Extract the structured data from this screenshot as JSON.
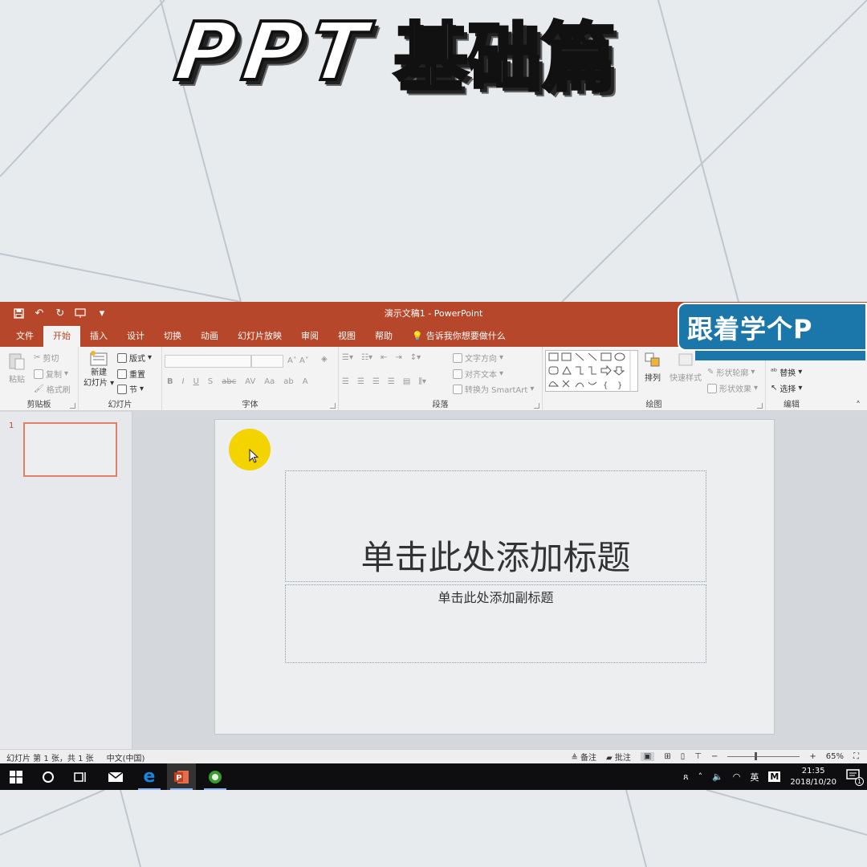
{
  "headline": {
    "ppt": "PPT",
    "cn": "基础篇"
  },
  "brand_tag": "跟着学个P",
  "window": {
    "doc_title": "演示文稿1  -  PowerPoint",
    "tabs": [
      "文件",
      "开始",
      "插入",
      "设计",
      "切换",
      "动画",
      "幻灯片放映",
      "审阅",
      "视图",
      "帮助"
    ],
    "active_tab": "开始",
    "tell_me": "告诉我你想要做什么",
    "ribbon": {
      "clipboard": {
        "label": "剪贴板",
        "paste": "粘贴",
        "cut": "剪切",
        "copy": "复制",
        "format_painter": "格式刷"
      },
      "slides": {
        "label": "幻灯片",
        "new_slide_1": "新建",
        "new_slide_2": "幻灯片",
        "layout": "版式",
        "reset": "重置",
        "section": "节"
      },
      "font": {
        "label": "字体",
        "bold": "B",
        "italic": "I",
        "underline": "U",
        "shadow": "S",
        "strike": "abc",
        "spacing": "AV",
        "case": "Aa",
        "highlight": "ab",
        "color": "A"
      },
      "paragraph": {
        "label": "段落",
        "text_direction": "文字方向",
        "align_text": "对齐文本",
        "smartart": "转换为 SmartArt"
      },
      "drawing": {
        "label": "绘图",
        "arrange": "排列",
        "quick_styles": "快速样式",
        "shape_outline": "形状轮廓",
        "shape_effects": "形状效果"
      },
      "editing": {
        "label": "编辑",
        "replace": "替换",
        "select": "选择"
      }
    },
    "thumbnail": {
      "number": "1"
    },
    "slide": {
      "title_placeholder": "单击此处添加标题",
      "subtitle_placeholder": "单击此处添加副标题"
    },
    "status": {
      "slide_info": "幻灯片 第 1 张，共 1 张",
      "language": "中文(中国)",
      "notes": "备注",
      "comments": "批注",
      "zoom": "65%"
    }
  },
  "taskbar": {
    "ime": "英",
    "time": "21:35",
    "date": "2018/10/20",
    "notification_count": "1"
  }
}
